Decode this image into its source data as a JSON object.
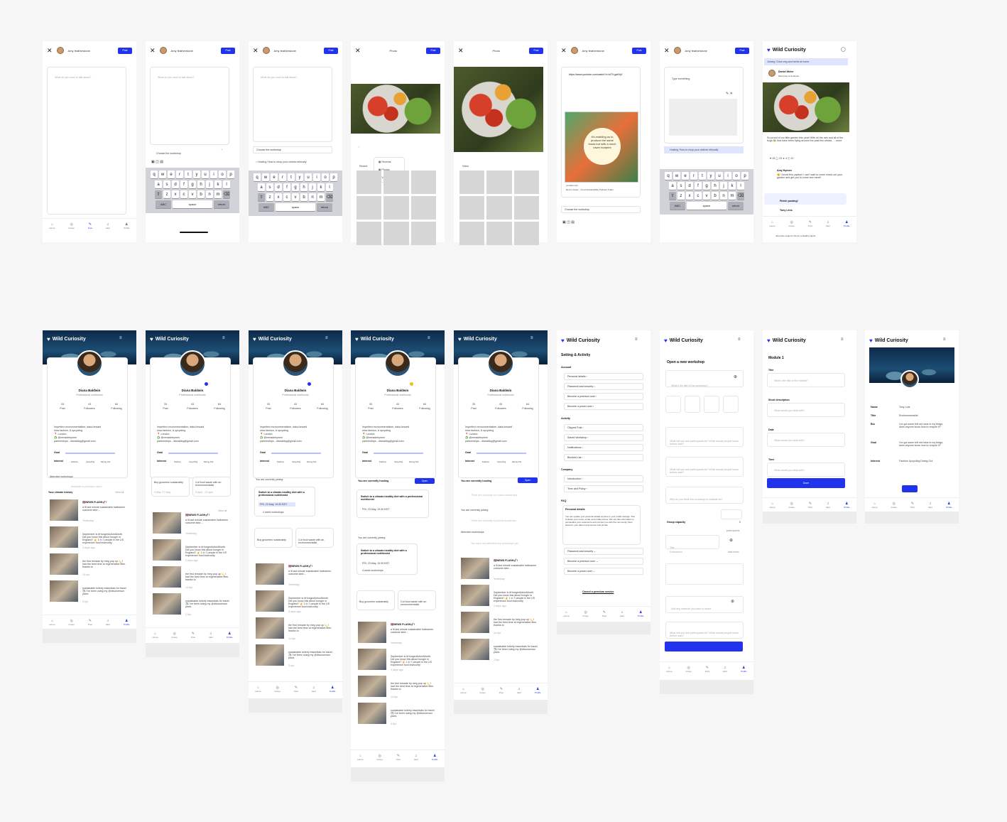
{
  "post_flow": {
    "author_name": "Amy featherstone",
    "post_label": "Post",
    "composer_placeholder": "What do you want to talk about?",
    "choose_workshop": "Choose the workshop",
    "workshop_options": [
      "Hosting 'How to shop your clothes ethically'",
      "Joining 'Grow veg and herbs at home"
    ],
    "photo_title": "Photo",
    "video_title": "Video",
    "recent_label": "Recent",
    "media_menu": [
      "Recents",
      "Photos",
      "Videos"
    ],
    "link_text": "https://www.youtube.com/watch?v=kl7V-gaKbjY",
    "video_overlay": "It's enabling us to produce the same foods but with a much lower footprint",
    "video_channel": "youtube.com",
    "video_caption": "Red to Green - Food Sustainability Podcast Trailer",
    "type_something": "Type something",
    "hosting_banner": "Hosting 'How to shop your clothes ethically'",
    "keyboard_rows": [
      [
        "q",
        "w",
        "e",
        "r",
        "t",
        "y",
        "u",
        "i",
        "o",
        "p"
      ],
      [
        "a",
        "s",
        "d",
        "f",
        "g",
        "h",
        "j",
        "k",
        "l"
      ],
      [
        "z",
        "x",
        "c",
        "v",
        "b",
        "n",
        "m"
      ]
    ],
    "kb_abc": "ABC",
    "kb_space": "space",
    "kb_return": "return"
  },
  "feed_preview": {
    "brand": "Wild Curiosity",
    "joining_banner": "Joining 'Grow veg and herbs at home",
    "poster": "Daniel Weier",
    "poster_sub": "Meal prep & workouts",
    "post_text": "So proud of our little garden this year! With all the rain and all of the bugs 🐝 that have been flying around the past few weeks, ....more",
    "stats": [
      "15",
      "23",
      "4",
      "22"
    ],
    "comment_author": "Amy Hymen",
    "comment_text": "😊 I loved this caption! I can't wait to come check out your garden and get you to come see mine!!",
    "finish_posting": "Finish posting!",
    "other_author": "Tony Lens",
    "footer_text": "Jane Doe support: this for a healthy planet"
  },
  "profile": {
    "brand": "Wild Curiosity",
    "name": "Diana Baldwin",
    "title": "Professional nutritionist",
    "stats": [
      {
        "num": "33",
        "label": "Post"
      },
      {
        "num": "43",
        "label": "Followers"
      },
      {
        "num": "64",
        "label": "Following"
      }
    ],
    "bio_lines": [
      "Imperfect environmentalism, data-forward",
      "slow fashion, & upcycling",
      "📍 London",
      "♻️ @remadebymen",
      "partnerships - dianablog@gmail.com"
    ],
    "goal_label": "Goal",
    "interest_label": "Interest",
    "interests": [
      "Fashion",
      "Upcycling",
      "Dining Out"
    ],
    "attended": "Attended workshops",
    "attended_empty": "Available to premium users",
    "climate_history": "Your climate history",
    "view_all": "View all",
    "currently_joining": "You are currently joining",
    "currently_hosting": "You are currently hosting",
    "hosting_empty": "There are currently no hosted workshops",
    "joining_empty": "There are currently no joined workshops",
    "attended_none": "You have not attended any workshops yet",
    "open_btn": "Open",
    "workshop_card": "Switch to a climate-healthy diet with a professional nutritionist",
    "workshop_date": "FRI, 23 May, 19:30 BST",
    "workshop_len": "4 week workshops",
    "small_cards": [
      {
        "t": "Buy groceries sustainably",
        "d": "4 May '27 May"
      },
      {
        "t": "Cut food waste with an environmentalist",
        "d": "8 April - 13 april"
      }
    ],
    "feed": [
      {
        "title": "🇬🇧NEWS FLASH🚀!",
        "text": "a lil last minute sustainable halloween costume idea ...",
        "time": "Yesterday"
      },
      {
        "title": "",
        "text": "September is #HungerActionMonth. Did you know this about hunger in England? ☝️ 1 in 7 people in the US experience food insecurity",
        "time": "3 days ago"
      },
      {
        "title": "",
        "text": "the first remade by meg pop up 💫 I had the best time at regenerative files. thanks to",
        "time": "14 Apr"
      },
      {
        "title": "",
        "text": "sustainable toiletry essentials for travel ✈️ I've been using my @discoversun plant-",
        "time": "3 Apr"
      }
    ]
  },
  "settings": {
    "brand": "Wild Curiosity",
    "title": "Setting & Activity",
    "sections": [
      {
        "name": "Account",
        "items": [
          "Personal details",
          "Password and security",
          "Become a premium user",
          "Become a power user"
        ]
      },
      {
        "name": "Activity",
        "items": [
          "Clipped Post",
          "Saved Workshop",
          "Notifications",
          "Blocked List"
        ]
      },
      {
        "name": "Company",
        "items": [
          "Introduction",
          "Term and Policy"
        ]
      }
    ],
    "faq": "FAQ",
    "faq_open": "Personal details",
    "faq_text": "You can update your personal details anytime in your profile settings. This includes your name, email, and profile picture. We use this information to personalize your experience and connect you with the community. Rest assured, your data is kept secure and private.",
    "faq_items": [
      "Password and security",
      "Become a premium user",
      "Become a power user"
    ],
    "cancel": "Cancel a premium service"
  },
  "new_workshop": {
    "brand": "Wild Curiosity",
    "title": "Open a new workshop",
    "q_title": "What's the title of the workshop?",
    "q_do": "What will you and participants do? What should people know before start?",
    "q_think": "Why do you think this workshop is suitable for?",
    "capacity": "Group capacity",
    "capacity_val": "0",
    "participants": "participants",
    "title_ph": "Title",
    "desc_ph": "Description",
    "add_more": "Add more",
    "add_material": "Add any material you want to share"
  },
  "module": {
    "brand": "Wild Curiosity",
    "title": "Module 1",
    "fields": [
      {
        "label": "Title",
        "ph": "What's the title of the module?"
      },
      {
        "label": "Short description",
        "ph": "What would you deal with?"
      },
      {
        "label": "Date",
        "ph": "What would you deal with?"
      },
      {
        "label": "Time",
        "ph": "What would you deal with?"
      }
    ],
    "done": "Done"
  },
  "edit_profile": {
    "brand": "Wild Curiosity",
    "rows": [
      {
        "label": "Name",
        "value": "Tony Lots"
      },
      {
        "label": "Title",
        "value": "Environmentalist"
      },
      {
        "label": "Bio",
        "value": "I've got some left red wine in my fridge, does anyone know how to recycle it?"
      },
      {
        "label": "Goal",
        "value": "I've got some left red wine in my fridge, does anyone know how to recycle it?"
      },
      {
        "label": "Interest",
        "value": "Fashion  Upcycling  Dining Out"
      }
    ]
  },
  "nav": [
    "Home",
    "Group",
    "Post",
    "Alert",
    "Profile"
  ]
}
